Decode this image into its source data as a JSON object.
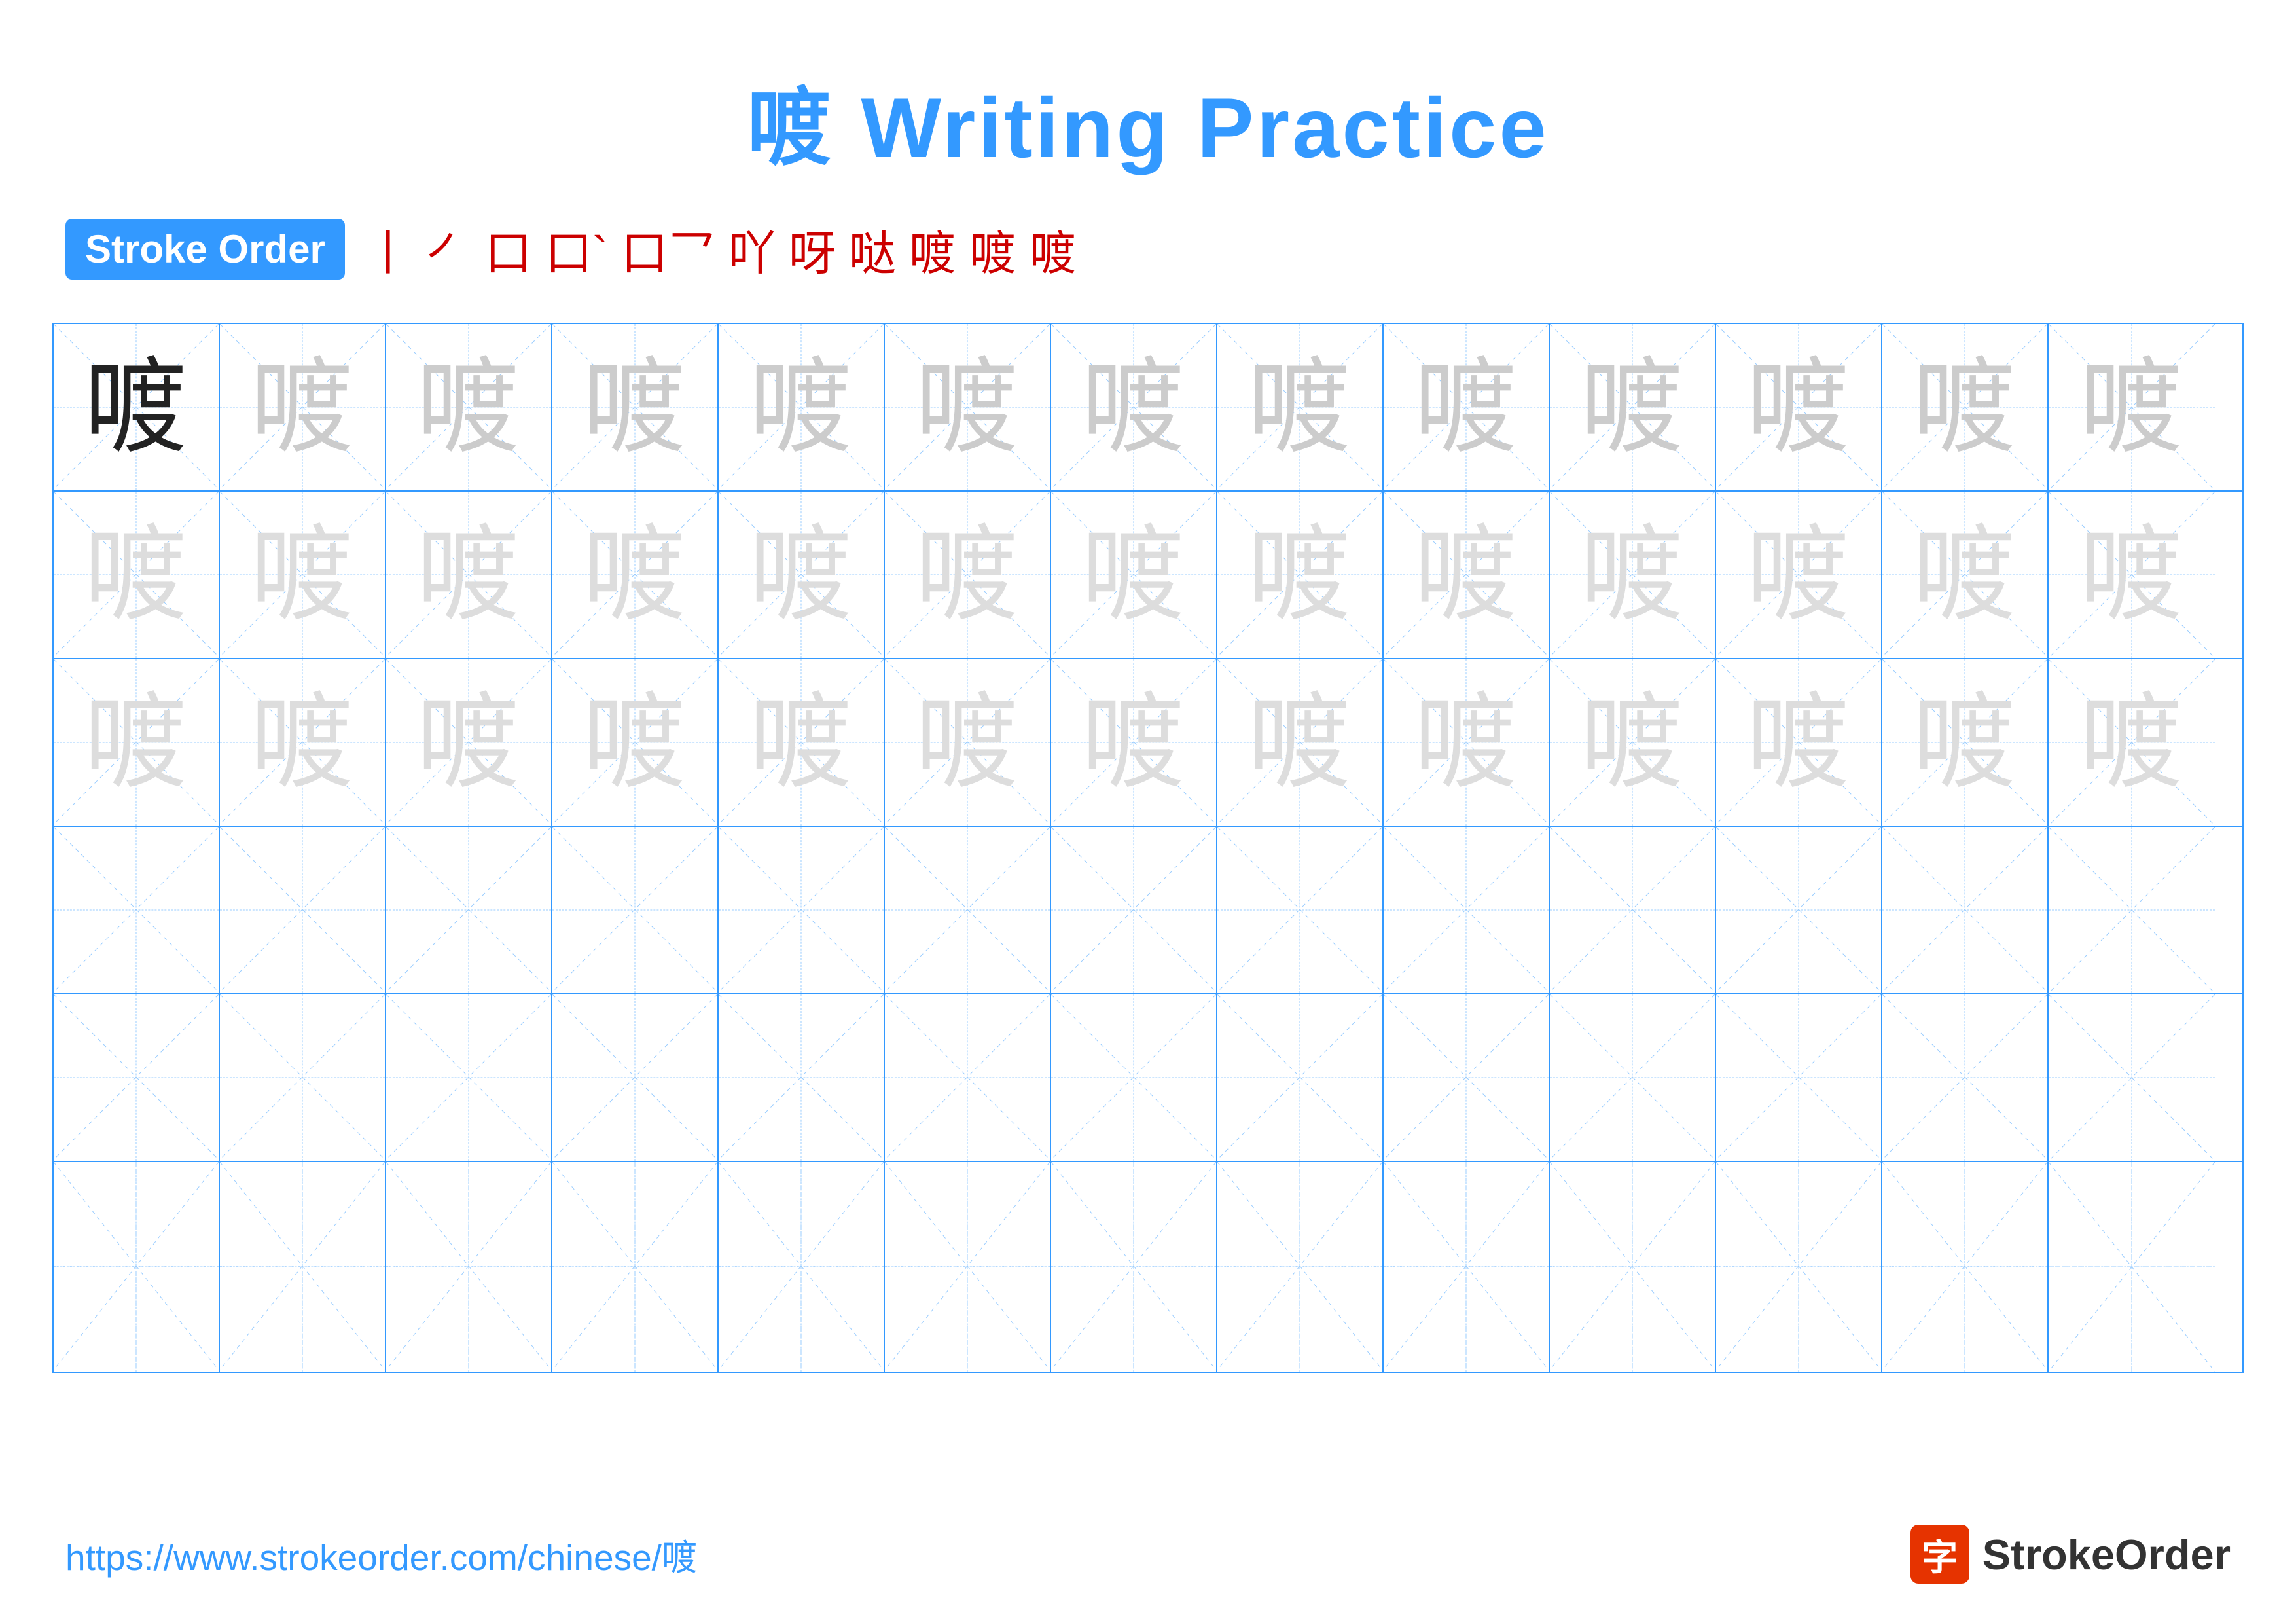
{
  "title": "喥 Writing Practice",
  "stroke_order": {
    "badge_label": "Stroke Order",
    "steps": [
      "丨",
      "㇒",
      "口",
      "口`",
      "口乛",
      "口乚",
      "呀",
      "哒",
      "喥",
      "喥",
      "喥"
    ]
  },
  "character": "喥",
  "grid": {
    "rows": 6,
    "cols": 13
  },
  "footer": {
    "url": "https://www.strokeorder.com/chinese/喥",
    "logo_text": "StrokeOrder",
    "logo_char": "字"
  }
}
